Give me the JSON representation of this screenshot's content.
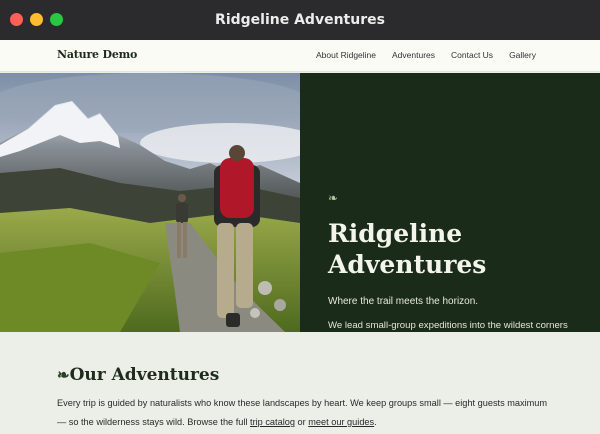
{
  "window": {
    "title": "Ridgeline Adventures"
  },
  "header": {
    "brand": "Nature Demo",
    "nav": [
      "About Ridgeline",
      "Adventures",
      "Contact Us",
      "Gallery"
    ]
  },
  "hero": {
    "ornament": "❧",
    "title_line1": "Ridgeline",
    "title_line2": "Adventures",
    "tagline": "Where the trail meets the horizon.",
    "description": "We lead small-group expeditions into the wildest corners of the Pacific Northwest — from alpine scrambles above the treeline to coastal kayaking through old-growth fjords.",
    "photo_description": "icon:hikers-mountain-trail-photo"
  },
  "section": {
    "ornament": "❧",
    "title": "Our Adventures",
    "body_before": "Every trip is guided by naturalists who know these landscapes by heart. We keep groups small — eight guests maximum — so the wilderness stays wild. Browse the full ",
    "link1": "trip catalog",
    "body_middle": " or ",
    "link2": "meet our guides",
    "body_after": "."
  },
  "colors": {
    "hero_panel": "#1b2b1a",
    "title_bar": "#2b2b2d",
    "page_bg": "#eceee8",
    "header_bg": "#fbfbf6"
  }
}
